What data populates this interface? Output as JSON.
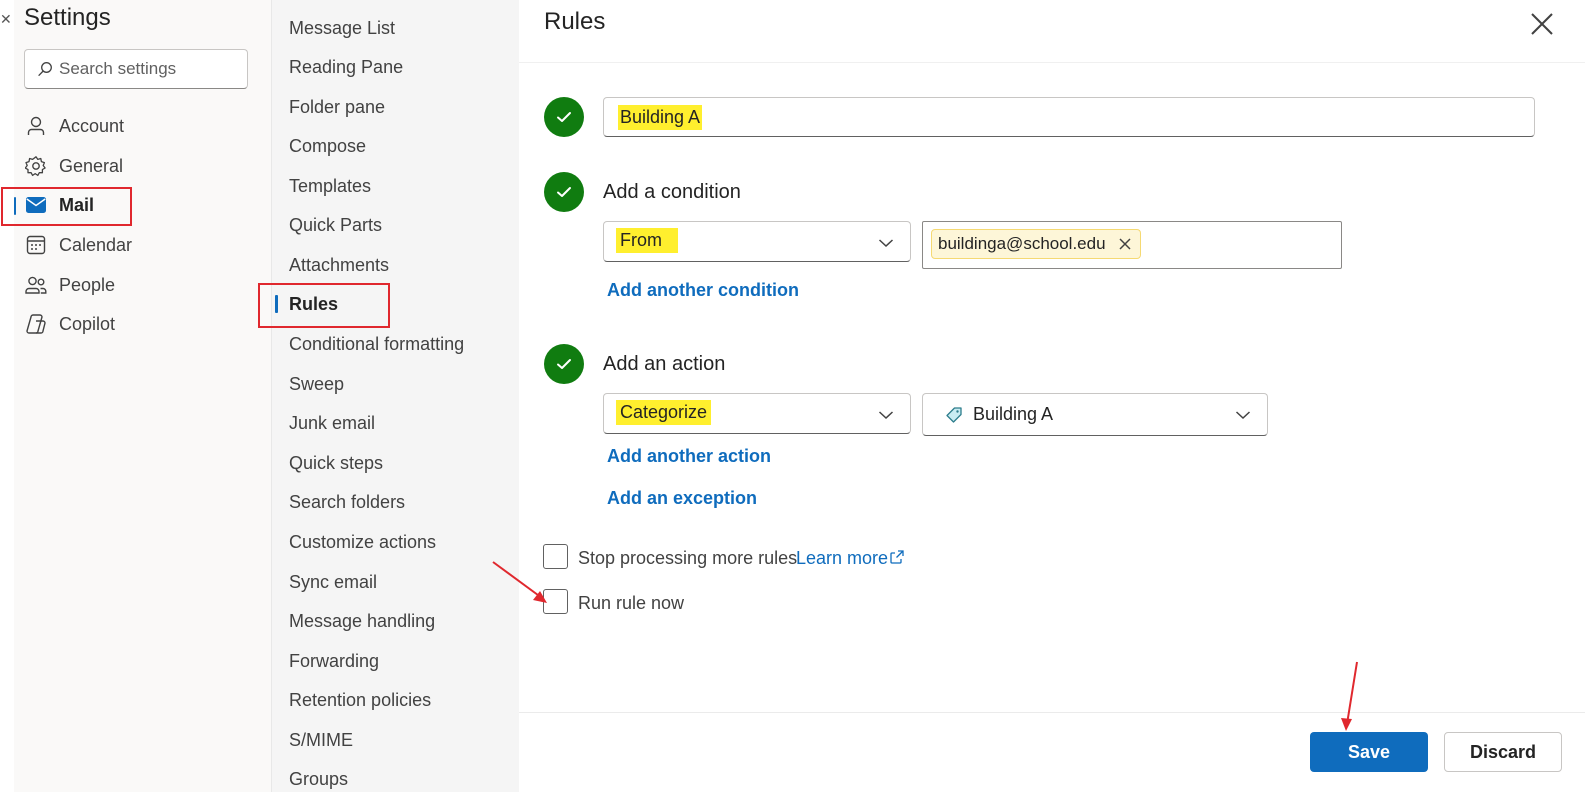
{
  "settings": {
    "title": "Settings",
    "search_placeholder": "Search settings",
    "nav": [
      {
        "label": "Account",
        "icon": "person-icon"
      },
      {
        "label": "General",
        "icon": "gear-icon"
      },
      {
        "label": "Mail",
        "icon": "mail-icon",
        "active": true
      },
      {
        "label": "Calendar",
        "icon": "calendar-icon"
      },
      {
        "label": "People",
        "icon": "people-icon"
      },
      {
        "label": "Copilot",
        "icon": "copilot-icon"
      }
    ]
  },
  "mail_menu": [
    "Message List",
    "Reading Pane",
    "Folder pane",
    "Compose",
    "Templates",
    "Quick Parts",
    "Attachments",
    "Rules",
    "Conditional formatting",
    "Sweep",
    "Junk email",
    "Quick steps",
    "Search folders",
    "Customize actions",
    "Sync email",
    "Message handling",
    "Forwarding",
    "Retention policies",
    "S/MIME",
    "Groups"
  ],
  "rules": {
    "title": "Rules",
    "rule_name": "Building A",
    "condition_label": "Add a condition",
    "condition_type": "From",
    "condition_token": "buildinga@school.edu",
    "add_condition": "Add another condition",
    "action_label": "Add an action",
    "action_type": "Categorize",
    "action_value": "Building A",
    "add_action": "Add another action",
    "add_exception": "Add an exception",
    "stop_processing": "Stop processing more rules",
    "learn_more": "Learn more",
    "run_now": "Run rule now",
    "save": "Save",
    "discard": "Discard"
  },
  "colors": {
    "accent": "#0f6cbd",
    "check": "#107c10",
    "highlight": "#ffef2e",
    "annotation": "#e0282e"
  }
}
